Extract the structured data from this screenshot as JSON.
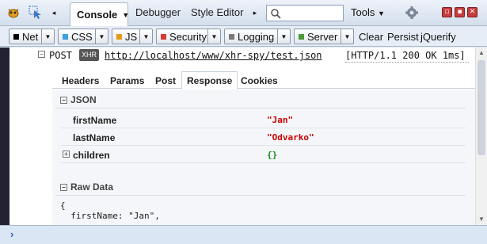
{
  "toolbar": {
    "console_tab": "Console",
    "tabs": [
      "Debugger",
      "Style Editor"
    ],
    "tools_label": "Tools"
  },
  "filters": [
    {
      "label": "Net",
      "color": "#000000"
    },
    {
      "label": "CSS",
      "color": "#3aa0e0"
    },
    {
      "label": "JS",
      "color": "#e69a1a"
    },
    {
      "label": "Security",
      "color": "#d33a3a"
    },
    {
      "label": "Logging",
      "color": "#7a7a7a"
    },
    {
      "label": "Server",
      "color": "#4a9a3a"
    }
  ],
  "actions": [
    "Clear",
    "Persist",
    "jQuerify"
  ],
  "request": {
    "method": "POST",
    "badge": "XHR",
    "url": "http://localhost/www/xhr-spy/test.json",
    "status": "[HTTP/1.1 200 OK 1ms]"
  },
  "netinfo": {
    "tabs": [
      "Headers",
      "Params",
      "Post",
      "Response",
      "Cookies"
    ],
    "active_tab": "Response",
    "json_title": "JSON",
    "rows": [
      {
        "key": "firstName",
        "value": "\"Jan\"",
        "color": "#cc0000"
      },
      {
        "key": "lastName",
        "value": "\"Odvarko\"",
        "color": "#cc0000"
      },
      {
        "key": "children",
        "value": "{}",
        "color": "#1a8a1a"
      }
    ],
    "raw_title": "Raw Data",
    "raw_lines": [
      "{",
      "  firstName: \"Jan\","
    ]
  }
}
